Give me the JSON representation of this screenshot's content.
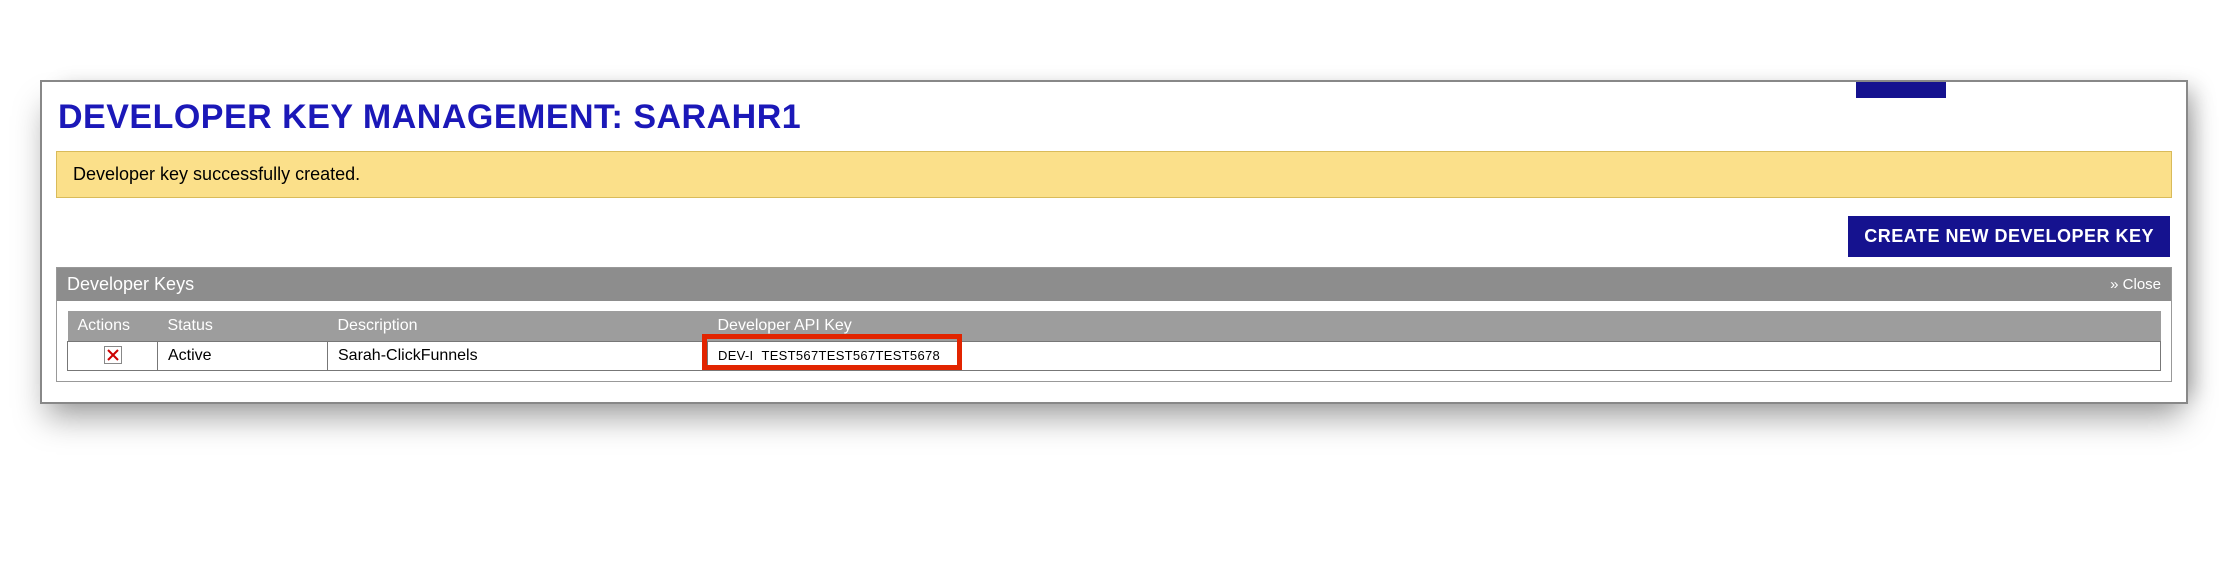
{
  "page": {
    "title": "DEVELOPER KEY MANAGEMENT: SARAHR1"
  },
  "notice": {
    "text": "Developer key successfully created."
  },
  "toolbar": {
    "create_label": "CREATE NEW DEVELOPER KEY"
  },
  "grid": {
    "title": "Developer Keys",
    "close_label": "» Close",
    "columns": {
      "actions": "Actions",
      "status": "Status",
      "description": "Description",
      "api_key": "Developer API Key"
    },
    "rows": [
      {
        "status": "Active",
        "description": "Sarah-ClickFunnels",
        "api_key_prefix": "DEV-I",
        "api_key_value": "TEST567TEST567TEST5678"
      }
    ]
  },
  "icons": {
    "delete": "delete-icon"
  }
}
